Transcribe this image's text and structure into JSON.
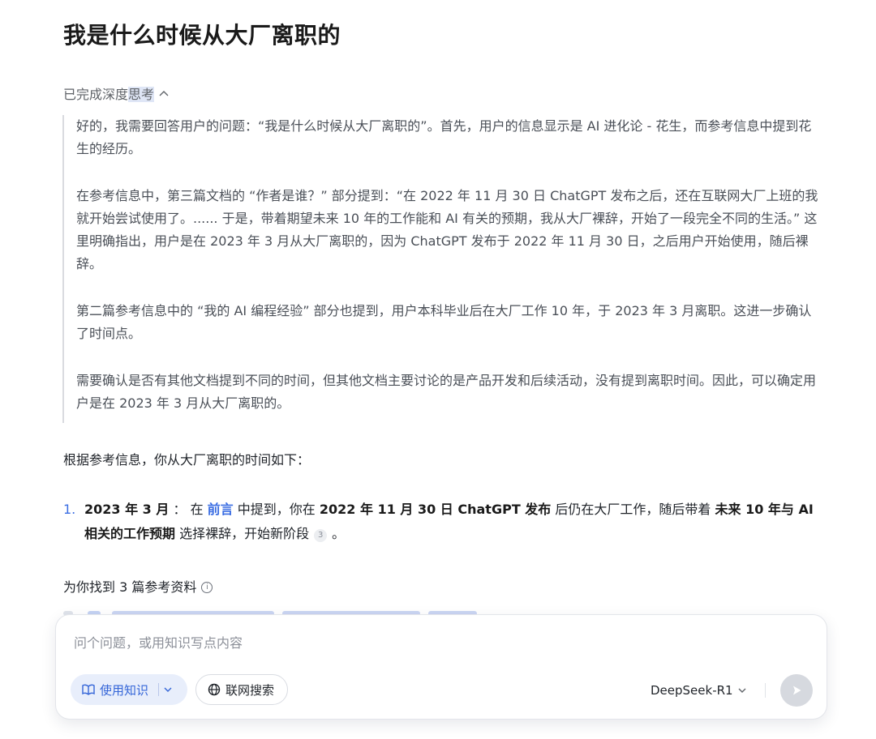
{
  "title": "我是什么时候从大厂离职的",
  "thinking": {
    "label_prefix": "已完成深度",
    "label_highlight": "思考",
    "paragraphs": [
      "好的，我需要回答用户的问题：“我是什么时候从大厂离职的”。首先，用户的信息显示是 AI 进化论 - 花生，而参考信息中提到花生的经历。",
      "在参考信息中，第三篇文档的 “作者是谁？” 部分提到：“在 2022 年 11 月 30 日 ChatGPT 发布之后，还在互联网大厂上班的我就开始尝试使用了。...... 于是，带着期望未来 10 年的工作能和 AI 有关的预期，我从大厂裸辞，开始了一段完全不同的生活。” 这里明确指出，用户是在 2023 年 3 月从大厂离职的，因为 ChatGPT 发布于 2022 年 11 月 30 日，之后用户开始使用，随后裸辞。",
      "第二篇参考信息中的 “我的 AI 编程经验” 部分也提到，用户本科毕业后在大厂工作 10 年，于 2023 年 3 月离职。这进一步确认了时间点。",
      "需要确认是否有其他文档提到不同的时间，但其他文档主要讨论的是产品开发和后续活动，没有提到离职时间。因此，可以确定用户是在 2023 年 3 月从大厂离职的。"
    ]
  },
  "answer": {
    "intro": "根据参考信息，你从大厂离职的时间如下：",
    "item_number": "1.",
    "seg_date": "2023 年 3 月",
    "seg_colon": "： 在",
    "seg_link": "前言",
    "seg_mid": "中提到，你在",
    "seg_event": "2022 年 11 月 30 日 ChatGPT 发布",
    "seg_after": "后仍在大厂工作，随后带着",
    "seg_expect": "未来 10 年与 AI 相关的工作预期",
    "seg_end": "选择裸辞，开始新阶段",
    "citation": "3",
    "seg_period": "。"
  },
  "references": {
    "label": "为你找到 3 篇参考资料",
    "info_glyph": "i"
  },
  "composer": {
    "placeholder": "问个问题，或用知识写点内容",
    "kb_label": "使用知识",
    "web_label": "联网搜索",
    "model": "DeepSeek-R1"
  },
  "colors": {
    "accent": "#3465d8",
    "reasoning_text": "#4a4f57",
    "send_disabled": "#d6d9df"
  }
}
